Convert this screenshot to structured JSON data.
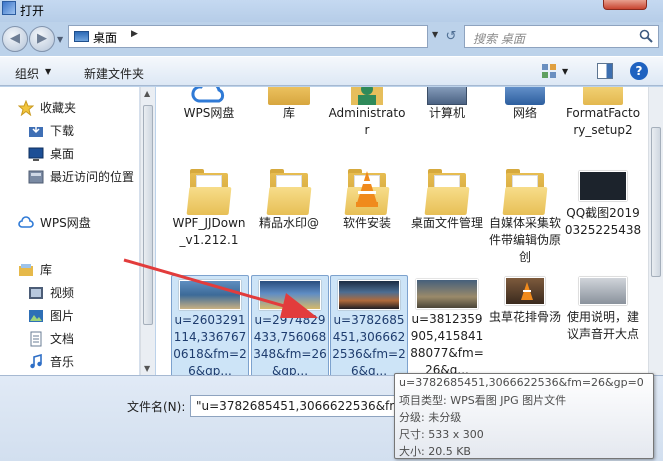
{
  "window": {
    "title": "打开"
  },
  "address": {
    "location": "桌面",
    "search_placeholder": "搜索 桌面"
  },
  "toolbar": {
    "organize": "组织",
    "new_folder": "新建文件夹"
  },
  "sidebar": {
    "items": [
      {
        "label": "收藏夹",
        "icon": "star-icon"
      },
      {
        "label": "下载",
        "icon": "download-folder-icon"
      },
      {
        "label": "桌面",
        "icon": "desktop-icon"
      },
      {
        "label": "最近访问的位置",
        "icon": "recent-places-icon"
      },
      {
        "label": "WPS网盘",
        "icon": "cloud-icon"
      },
      {
        "label": "库",
        "icon": "library-icon"
      },
      {
        "label": "视频",
        "icon": "video-icon"
      },
      {
        "label": "图片",
        "icon": "pictures-icon"
      },
      {
        "label": "文档",
        "icon": "documents-icon"
      },
      {
        "label": "音乐",
        "icon": "music-icon"
      }
    ]
  },
  "files": {
    "row1": [
      {
        "label": "WPS网盘",
        "icon": "wps-cloud-icon"
      },
      {
        "label": "库",
        "icon": "library-icon"
      },
      {
        "label": "Administrator",
        "icon": "user-icon"
      },
      {
        "label": "计算机",
        "icon": "computer-icon"
      },
      {
        "label": "网络",
        "icon": "network-icon"
      },
      {
        "label": "FormatFactory_setup2",
        "icon": "setup-folder-icon"
      }
    ],
    "row2": [
      {
        "label": "WPF_JJDown_v1.212.1",
        "icon": "folder-icon"
      },
      {
        "label": "精品水印@",
        "icon": "folder-icon"
      },
      {
        "label": "软件安装",
        "icon": "vlc-folder-icon"
      },
      {
        "label": "桌面文件管理",
        "icon": "folder-icon"
      },
      {
        "label": "自媒体采集软件带编辑伪原创",
        "icon": "folder-icon"
      },
      {
        "label": "QQ截图20190325225438",
        "icon": "screenshot-thumbnail"
      }
    ],
    "row3": [
      {
        "label": "u=2603291114,3367670618&fm=26&gp...",
        "icon": "image-thumbnail"
      },
      {
        "label": "u=2974829433,756068348&fm=26&gp...",
        "icon": "image-thumbnail"
      },
      {
        "label": "u=3782685451,3066622536&fm=26&g...",
        "icon": "image-thumbnail"
      },
      {
        "label": "u=3812359905,41584188077&fm=26&q...",
        "icon": "image-thumbnail"
      },
      {
        "label": "虫草花排骨汤",
        "icon": "image-thumbnail"
      },
      {
        "label": "使用说明，建议声音开大点",
        "icon": "video-thumbnail"
      }
    ]
  },
  "filename": {
    "label": "文件名(N):",
    "value": "\"u=3782685451,3066622536&fm="
  },
  "tooltip": {
    "lines": [
      "u=3782685451,3066622536&fm=26&gp=0",
      "项目类型: WPS看图 JPG 图片文件",
      "分级: 未分级",
      "尺寸: 533 x 300",
      "大小: 20.5 KB"
    ]
  },
  "colors": {
    "selection": "#cde4f7",
    "annotation_arrow": "#e23c3c",
    "window_frame": "#bcd2ea"
  }
}
